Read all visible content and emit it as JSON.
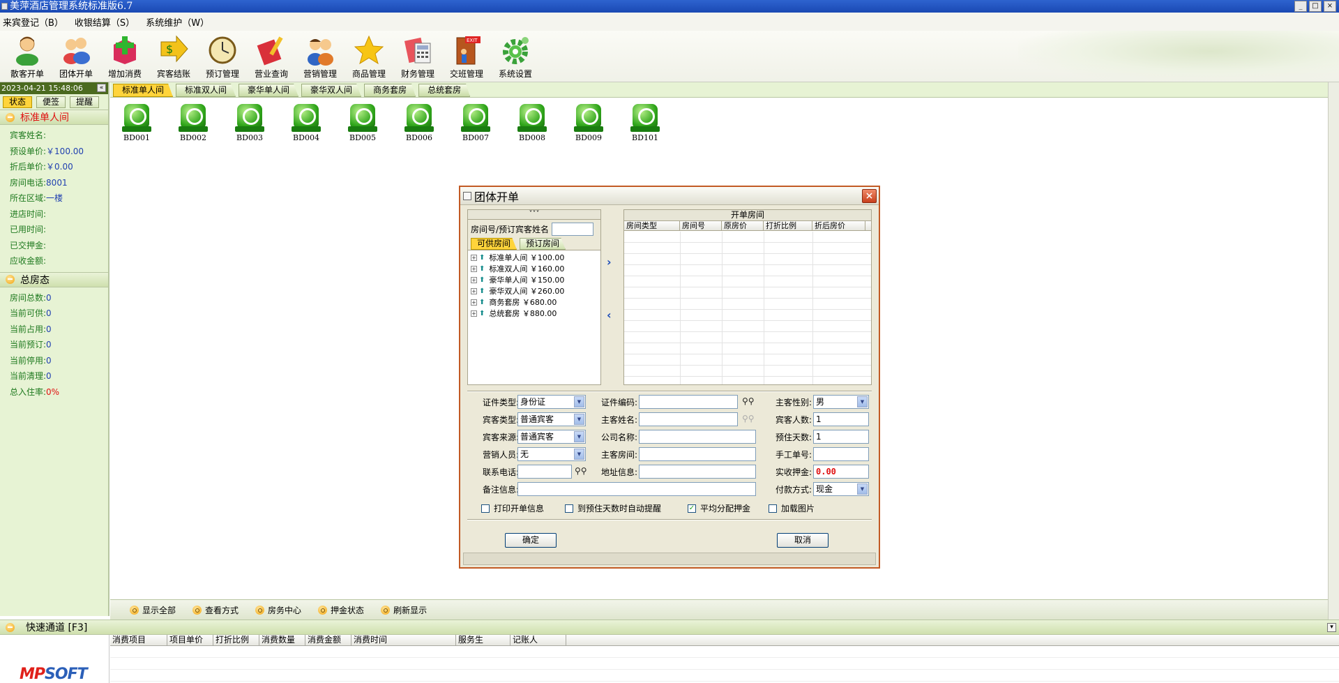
{
  "window": {
    "title": "美萍酒店管理系统标准版6.7",
    "buttons": [
      "_",
      "□",
      "×"
    ]
  },
  "menu": [
    {
      "label": "来宾登记（B）"
    },
    {
      "label": "收银结算（S）"
    },
    {
      "label": "系统维护（W）"
    }
  ],
  "toolbar": [
    {
      "label": "散客开单",
      "icon": "person-icon"
    },
    {
      "label": "团体开单",
      "icon": "group-icon"
    },
    {
      "label": "增加消费",
      "icon": "add-consume-icon"
    },
    {
      "label": "宾客结账",
      "icon": "checkout-icon"
    },
    {
      "label": "预订管理",
      "icon": "clock-icon"
    },
    {
      "label": "营业查询",
      "icon": "query-icon"
    },
    {
      "label": "营销管理",
      "icon": "marketing-icon"
    },
    {
      "label": "商品管理",
      "icon": "star-icon"
    },
    {
      "label": "财务管理",
      "icon": "calculator-icon"
    },
    {
      "label": "交班管理",
      "icon": "exit-icon"
    },
    {
      "label": "系统设置",
      "icon": "gear-icon"
    }
  ],
  "left": {
    "datetime": "2023-04-21 15:48:06",
    "collapse": "«",
    "tabs": [
      "状态",
      "便签",
      "提醒"
    ],
    "section1": {
      "title": "标准单人间",
      "rows": [
        {
          "label": "宾客姓名:",
          "value": ""
        },
        {
          "label": "预设单价:",
          "value": "￥100.00"
        },
        {
          "label": "折后单价:",
          "value": "￥0.00"
        },
        {
          "label": "房间电话:",
          "value": "8001"
        },
        {
          "label": "所在区域:",
          "value": "一楼"
        },
        {
          "label": "进店时间:",
          "value": ""
        },
        {
          "label": "已用时间:",
          "value": ""
        },
        {
          "label": "已交押金:",
          "value": ""
        },
        {
          "label": "应收金额:",
          "value": ""
        }
      ]
    },
    "section2": {
      "title": "总房态",
      "rows": [
        {
          "label": "房间总数:",
          "value": "0"
        },
        {
          "label": "当前可供:",
          "value": "0"
        },
        {
          "label": "当前占用:",
          "value": "0"
        },
        {
          "label": "当前预订:",
          "value": "0"
        },
        {
          "label": "当前停用:",
          "value": "0"
        },
        {
          "label": "当前清理:",
          "value": "0"
        },
        {
          "label": "总入住率:",
          "value": "0%"
        }
      ]
    }
  },
  "room_tabs": [
    "标准单人间",
    "标准双人间",
    "豪华单人间",
    "豪华双人间",
    "商务套房",
    "总统套房"
  ],
  "rooms": [
    "BD001",
    "BD002",
    "BD003",
    "BD004",
    "BD005",
    "BD006",
    "BD007",
    "BD008",
    "BD009",
    "BD101"
  ],
  "bottom_actions": [
    "显示全部",
    "查看方式",
    "房务中心",
    "押金状态",
    "刷新显示"
  ],
  "quick": {
    "title": "快速通道 [F3]",
    "expand": "¥"
  },
  "logo": {
    "part1": "MP",
    "part2": "SOFT"
  },
  "consume_grid": {
    "columns": [
      "消费项目",
      "项目单价",
      "打折比例",
      "消费数量",
      "消费金额",
      "消费时间",
      "服务生",
      "记账人"
    ]
  },
  "dialog": {
    "title": "团体开单",
    "close": "×",
    "left_head": "˅˅˅",
    "search_label": "房间号/预订宾客姓名",
    "search_value": "",
    "sub_tabs": [
      "可供房间",
      "预订房间"
    ],
    "tree": [
      {
        "name": "标准单人间",
        "price": "￥100.00"
      },
      {
        "name": "标准双人间",
        "price": "￥160.00"
      },
      {
        "name": "豪华单人间",
        "price": "￥150.00"
      },
      {
        "name": "豪华双人间",
        "price": "￥260.00"
      },
      {
        "name": "商务套房",
        "price": "￥680.00"
      },
      {
        "name": "总统套房",
        "price": "￥880.00"
      }
    ],
    "move_right": "›",
    "move_left": "‹",
    "right_head": "开单房间",
    "right_columns": [
      "房间类型",
      "房间号",
      "原房价",
      "打折比例",
      "折后房价"
    ],
    "fields": {
      "id_type_label": "证件类型:",
      "id_type": "身份证",
      "id_no_label": "证件编码:",
      "id_no": "",
      "gender_label": "主客性别:",
      "gender": "男",
      "guest_type_label": "宾客类型:",
      "guest_type": "普通宾客",
      "main_name_label": "主客姓名:",
      "main_name": "",
      "guest_count_label": "宾客人数:",
      "guest_count": "1",
      "source_label": "宾客来源:",
      "source": "普通宾客",
      "company_label": "公司名称:",
      "company": "",
      "days_label": "预住天数:",
      "days": "1",
      "sales_label": "营销人员:",
      "sales": "无",
      "main_room_label": "主客房间:",
      "main_room": "",
      "manual_no_label": "手工单号:",
      "manual_no": "",
      "phone_label": "联系电话:",
      "phone": "",
      "address_label": "地址信息:",
      "address": "",
      "deposit_label": "实收押金:",
      "deposit": "0.00",
      "remark_label": "备注信息:",
      "remark": "",
      "pay_label": "付款方式:",
      "pay": "现金"
    },
    "checks": [
      {
        "label": "打印开单信息",
        "checked": false
      },
      {
        "label": "到预住天数时自动提醒",
        "checked": false
      },
      {
        "label": "平均分配押金",
        "checked": true
      },
      {
        "label": "加载图片",
        "checked": false
      }
    ],
    "ok": "确定",
    "cancel": "取消"
  }
}
